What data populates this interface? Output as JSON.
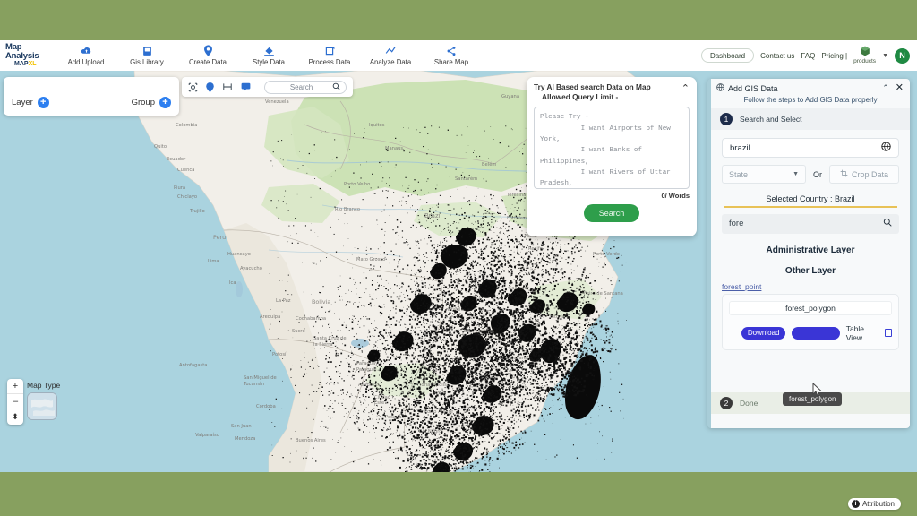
{
  "brand": {
    "line1": "Map Analysis",
    "line2_main": "MAP",
    "line2_accent": "XL"
  },
  "nav": {
    "items": [
      {
        "label": "Add Upload",
        "icon": "cloud-upload-icon"
      },
      {
        "label": "Gis Library",
        "icon": "library-icon"
      },
      {
        "label": "Create Data",
        "icon": "map-pin-icon"
      },
      {
        "label": "Style Data",
        "icon": "style-paint-icon"
      },
      {
        "label": "Process Data",
        "icon": "process-icon"
      },
      {
        "label": "Analyze Data",
        "icon": "analyze-icon"
      },
      {
        "label": "Share Map",
        "icon": "share-icon"
      }
    ],
    "dashboard": "Dashboard",
    "contact": "Contact us",
    "faq": "FAQ",
    "pricing": "Pricing |",
    "products": "products",
    "avatar_initial": "N"
  },
  "layer_panel": {
    "layer_label": "Layer",
    "group_label": "Group",
    "add_symbol": "+"
  },
  "map_toolbar": {
    "icons": [
      "fullscreen-crosshair-icon",
      "marker-pin-icon",
      "measure-icon",
      "comment-icon"
    ],
    "search_placeholder": "Search"
  },
  "ai_panel": {
    "title_line1": "Try AI Based search Data on Map",
    "title_line2": "Allowed Query Limit -",
    "collapse_icon": "chevron-up-icon",
    "textarea_value": "Please Try -\n          I want Airports of New\nYork,\n          I want Banks of\nPhilippines,\n          I want Rivers of Uttar\nPradesh,\n          I want Atms of London",
    "word_count": "0/ Words",
    "search_button": "Search"
  },
  "map_controls": {
    "zoom_in": "+",
    "zoom_out": "–",
    "compass": "⬍",
    "map_type_label": "Map Type"
  },
  "attribution": {
    "label": "Attribution",
    "badge": "i"
  },
  "gis_panel": {
    "title": "Add GIS Data",
    "title_icon": "globe-grid-icon",
    "collapse_icon": "chevron-up-icon",
    "close_icon": "close-icon",
    "subtitle": "Follow the steps to Add GIS Data properly",
    "step1_num": "1",
    "step1_label": "Search and Select",
    "country_value": "brazil",
    "country_icon": "globe-icon",
    "state_placeholder": "State",
    "or_label": "Or",
    "crop_button": "Crop Data",
    "crop_icon": "crop-icon",
    "selected_country": "Selected Country : Brazil",
    "layer_search_value": "fore",
    "layer_search_icon": "search-icon",
    "administrative_layer": "Administrative Layer",
    "other_layer": "Other Layer",
    "forest_point_link": "forest_point",
    "forest_polygon_name": "forest_polygon",
    "download_button": "Download",
    "add_button": "",
    "table_view": "Table View",
    "table_view_icon": "table-icon",
    "tooltip_text": "forest_polygon",
    "step2_num": "2",
    "step2_label": "Done"
  },
  "colors": {
    "page_border": "#87a05f",
    "water": "#aad3df",
    "land": "#f2efe9",
    "forest": "#c8dfb0",
    "data_points": "#111111",
    "accent_blue": "#2d7ff0",
    "button_purple": "#3a35d6",
    "green_button": "#2e9e4b"
  }
}
